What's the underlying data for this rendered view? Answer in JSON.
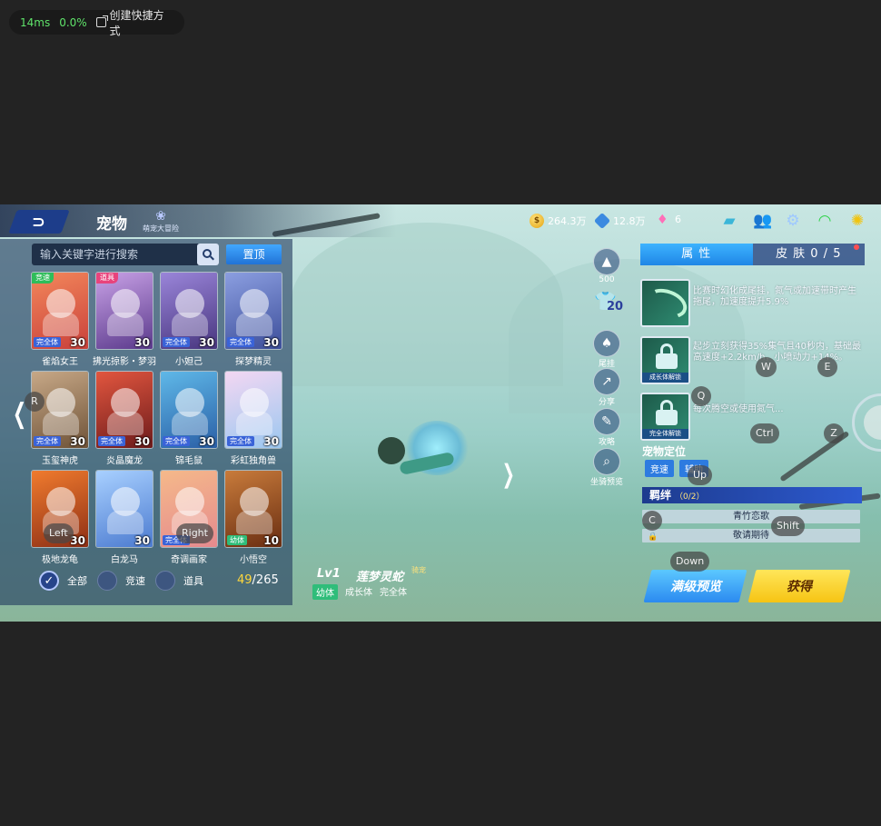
{
  "overlay": {
    "latency": "14ms",
    "loss": "0.0%",
    "shortcut_label": "创建快捷方式"
  },
  "topbar": {
    "back_icon": "back-arrow-icon",
    "title": "宠物",
    "event_label": "萌宠大冒险",
    "coins": "264.3万",
    "gems": "12.8万",
    "diamonds": "6"
  },
  "search": {
    "placeholder": "输入关键字进行搜索",
    "pin_label": "置顶"
  },
  "pets": [
    {
      "name": "雀焰女王",
      "tag": "竞速",
      "grade": "完全体",
      "level": "30",
      "color1": "#f3875b",
      "color2": "#c9413b"
    },
    {
      "name": "拂光掠影・梦羽",
      "tag": "道具",
      "grade": "",
      "level": "30",
      "color1": "#c8a1e6",
      "color2": "#5b3a8c"
    },
    {
      "name": "小妲己",
      "tag": "",
      "grade": "完全体",
      "level": "30",
      "color1": "#9a85d9",
      "color2": "#48367f"
    },
    {
      "name": "探梦精灵",
      "tag": "",
      "grade": "完全体",
      "level": "30",
      "color1": "#8b9ee0",
      "color2": "#3d4f9b"
    },
    {
      "name": "玉玺神虎",
      "tag": "",
      "grade": "完全体",
      "level": "30",
      "color1": "#c7a887",
      "color2": "#6f5338"
    },
    {
      "name": "炎晶魔龙",
      "tag": "",
      "grade": "完全体",
      "level": "30",
      "color1": "#e2563f",
      "color2": "#6d1b1b"
    },
    {
      "name": "锦毛鼠",
      "tag": "",
      "grade": "完全体",
      "level": "30",
      "color1": "#5fb8e8",
      "color2": "#2a5fa6"
    },
    {
      "name": "彩虹独角兽",
      "tag": "",
      "grade": "完全体",
      "level": "30",
      "color1": "#f3d7f2",
      "color2": "#9bc7f0"
    },
    {
      "name": "极地龙龟",
      "tag": "",
      "grade": "",
      "level": "30",
      "color1": "#f07b2e",
      "color2": "#8e2f15"
    },
    {
      "name": "白龙马",
      "tag": "",
      "grade": "",
      "level": "30",
      "color1": "#a8d0ff",
      "color2": "#4c7bd0"
    },
    {
      "name": "奇调画家",
      "tag": "",
      "grade": "完全体",
      "level": "",
      "color1": "#f5b98a",
      "color2": "#e58a8e"
    },
    {
      "name": "小悟空",
      "tag": "",
      "grade": "幼体",
      "level": "10",
      "color1": "#c87b3b",
      "color2": "#6a2e12"
    }
  ],
  "filters": [
    {
      "label": "全部",
      "checked": true
    },
    {
      "label": "竞速",
      "checked": false
    },
    {
      "label": "道具",
      "checked": false
    }
  ],
  "count": {
    "current": "49",
    "total": "/265"
  },
  "side_menu": {
    "score": "500",
    "level": "20",
    "tail_label": "尾挂",
    "share_label": "分享",
    "guide_label": "攻略",
    "mount_label": "坐骑预览"
  },
  "pet_info": {
    "level": "Lv1",
    "name": "莲梦灵蛇",
    "special": "骑宠",
    "stage": "幼体",
    "growth": "成长体",
    "complete": "完全体"
  },
  "right_panel": {
    "tab_attr": "属 性",
    "tab_skin": "皮 肤 0 / 5",
    "skills": [
      {
        "desc": "比赛时幻化成尾挂，氮气或加速带时产生拖尾，加速度提升5.9%",
        "caption": ""
      },
      {
        "desc": "起步立刻获得35%集气且40秒内，基础最高速度+2.2km/h，小喷动力+14%。",
        "caption": "成长体解锁"
      },
      {
        "desc": "每次腾空或使用氮气...",
        "caption": "完全体解锁"
      }
    ],
    "position_title": "宠物定位",
    "position_tags": [
      "竞速",
      "辅助"
    ],
    "bond_title": "羁绊",
    "bond_count": "（0/2）",
    "bond_rows": [
      "青竹恋歌",
      "敬请期待"
    ],
    "btn_preview": "满级预览",
    "btn_get": "获得"
  },
  "keymap": {
    "w": "W",
    "e": "E",
    "q": "Q",
    "ctrl": "Ctrl",
    "z": "Z",
    "up": "Up",
    "c": "C",
    "shift": "Shift",
    "down": "Down",
    "r": "R",
    "left": "Left",
    "right": "Right"
  }
}
